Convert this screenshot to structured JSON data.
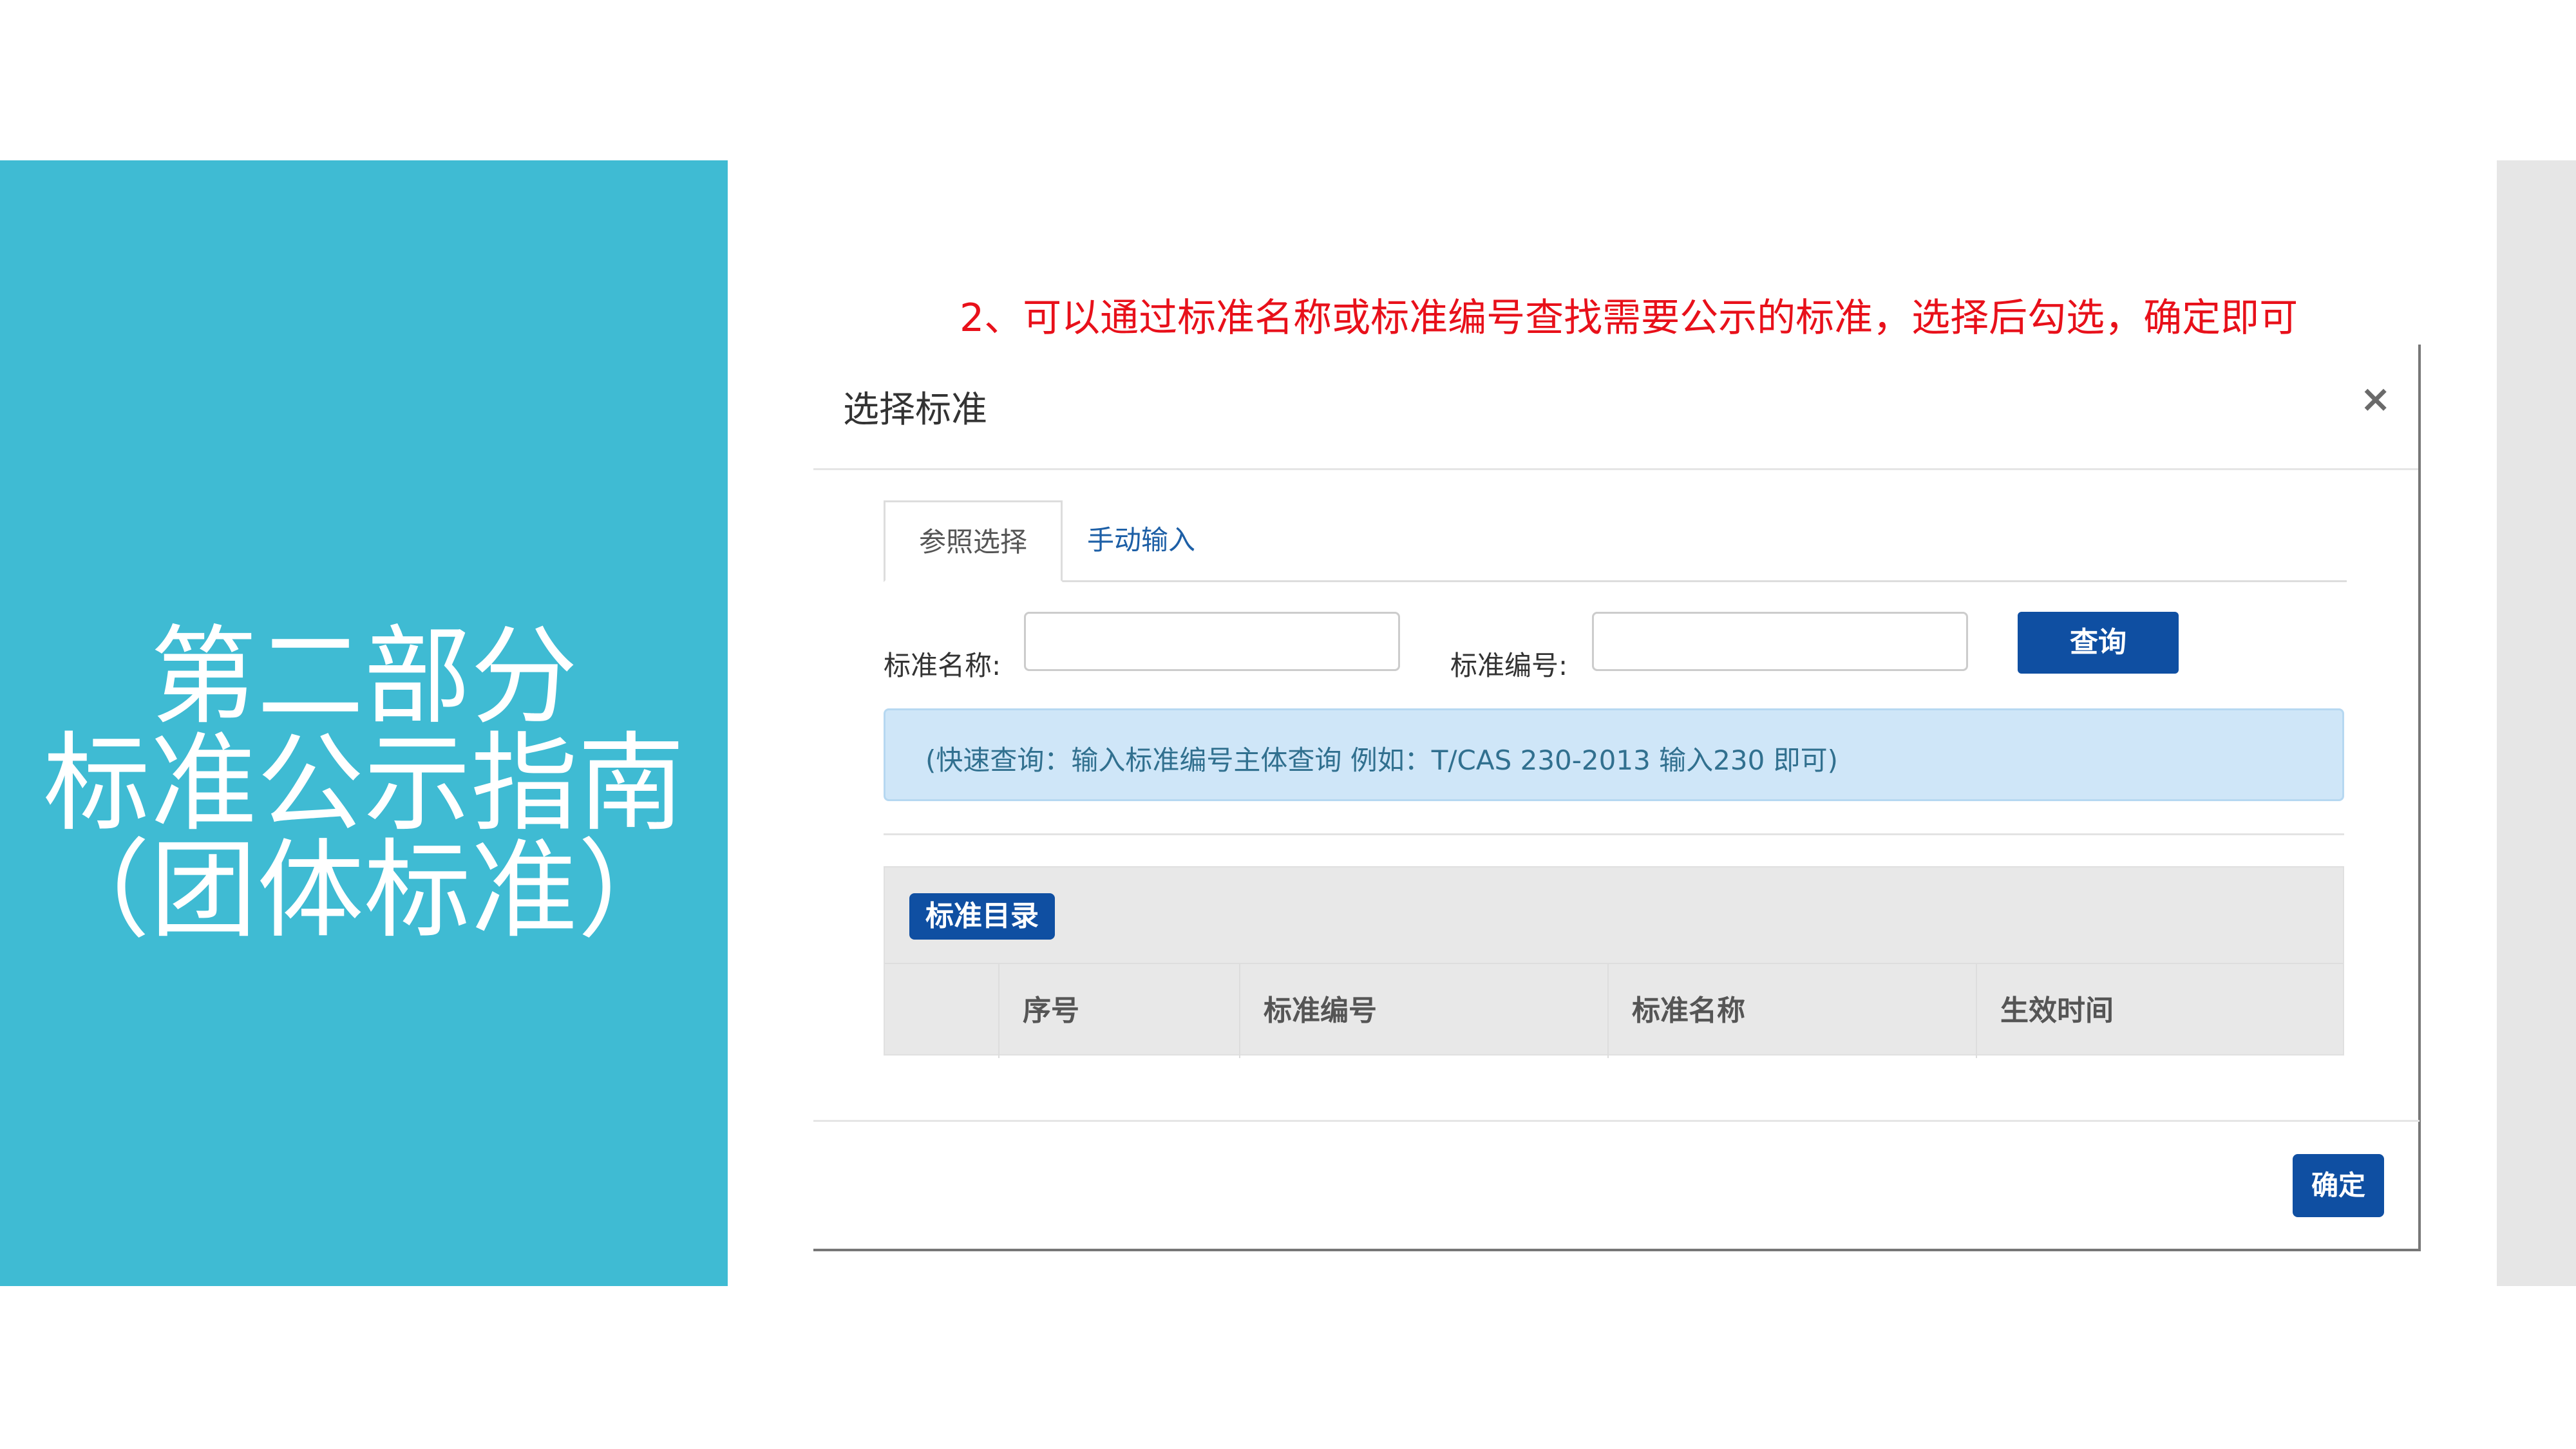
{
  "slide": {
    "section_title_lines": [
      "第二部分",
      "标准公示指南",
      "（团体标准）"
    ],
    "instruction": "2、可以通过标准名称或标准编号查找需要公示的标准，选择后勾选，确定即可"
  },
  "modal": {
    "title": "选择标准",
    "close_symbol": "×",
    "tabs": [
      {
        "label": "参照选择",
        "active": true
      },
      {
        "label": "手动输入",
        "active": false
      }
    ],
    "form": {
      "name_label": "标准名称:",
      "name_value": "",
      "number_label": "标准编号:",
      "number_value": "",
      "query_button": "查询"
    },
    "hint": "(快速查询：输入标准编号主体查询 例如：T/CAS 230-2013 输入230 即可)",
    "catalog": {
      "badge": "标准目录",
      "columns": [
        "",
        "序号",
        "标准编号",
        "标准名称",
        "生效时间"
      ]
    },
    "confirm_button": "确定"
  },
  "colors": {
    "left_panel": "#3fbbd3",
    "instruction_text": "#e8101a",
    "primary_button": "#0f4fa2",
    "hint_background": "#cfe6f8"
  }
}
